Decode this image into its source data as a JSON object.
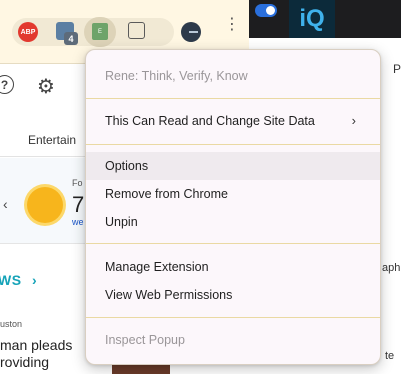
{
  "toolbar": {
    "extensions": [
      {
        "name": "abp-icon",
        "label": "ABP"
      },
      {
        "name": "extension-badge-icon",
        "badge": "4"
      },
      {
        "name": "active-extension-icon",
        "label": "E"
      },
      {
        "name": "puzzle-icon"
      },
      {
        "name": "profile-icon"
      },
      {
        "name": "kebab-menu-icon",
        "glyph": "⋮"
      }
    ]
  },
  "right_window": {
    "brand": "iQ",
    "letter": "P",
    "text1": "aph",
    "text2": "te"
  },
  "page": {
    "help_glyph": "?",
    "gear_glyph": "⚙",
    "nav_tab": "Entertain",
    "weather": {
      "chevron": "‹",
      "label": "Fo",
      "temp": "7",
      "link": "we"
    },
    "news_heading": "WS",
    "news_chevron": "›",
    "news_source": "uston",
    "news_line1": "man pleads",
    "news_line2": "roviding"
  },
  "menu": {
    "header": "Rene: Think, Verify, Know",
    "site_data": "This Can Read and Change Site Data",
    "site_data_chevron": "›",
    "options": "Options",
    "remove": "Remove from Chrome",
    "unpin": "Unpin",
    "manage": "Manage Extension",
    "permissions": "View Web Permissions",
    "inspect": "Inspect Popup"
  },
  "colors": {
    "menu_bg": "#fcf7fb",
    "separator": "#ead9a3",
    "highlight": "#efeaee",
    "news_accent": "#16a3b8"
  }
}
